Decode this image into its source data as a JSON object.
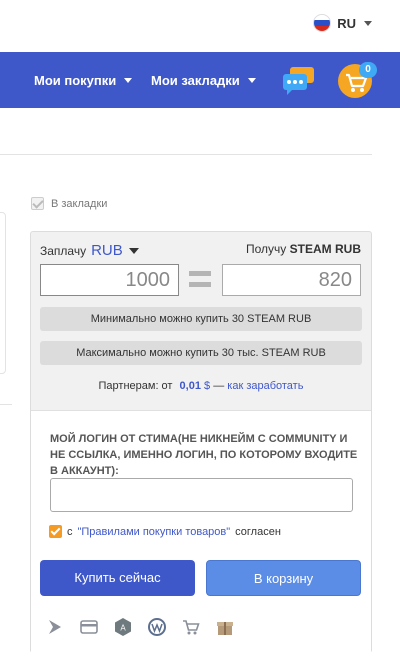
{
  "header": {
    "language": {
      "code": "RU",
      "flag_colors": [
        "#ffffff",
        "#2b4fc7",
        "#d52b1e"
      ]
    },
    "nav": {
      "purchases_label": "Мои покупки",
      "bookmarks_label": "Мои закладки"
    },
    "chat_icon": "chat-bubbles-icon",
    "cart_icon": "shopping-cart-icon",
    "cart_count": "0"
  },
  "bookmark": {
    "label": "В закладки",
    "checked": true
  },
  "widget": {
    "pay_label": "Заплачу",
    "pay_currency": "RUB",
    "get_label": "Получу",
    "get_currency": "STEAM RUB",
    "pay_value": "1000",
    "get_value": "820",
    "min_text": "Минимально можно купить 30 STEAM RUB",
    "max_text": "Максимально можно купить 30 тыс. STEAM RUB",
    "partners": {
      "prefix": "Партнерам: от",
      "value": "0,01",
      "currency": "$",
      "dash": "—",
      "link": "как заработать"
    },
    "login_label": "Мой логин от стима(не никнейм с community и не ссылка, именно логин, по которому входите в аккаунт):",
    "login_value": "",
    "agree": {
      "prefix": "с",
      "link": "\"Правилами покупки товаров\"",
      "suffix": "согласен",
      "checked": true
    },
    "buy_label": "Купить сейчас",
    "cart_label": "В корзину",
    "payment_icons": [
      "bitcoin-icon",
      "card-icon",
      "yandex-money-icon",
      "webmoney-icon",
      "qiwi-cart-icon",
      "gift-icon"
    ]
  },
  "colors": {
    "brand": "#3f58c9",
    "accent": "#f5a623",
    "button_secondary": "#5b8de6"
  }
}
